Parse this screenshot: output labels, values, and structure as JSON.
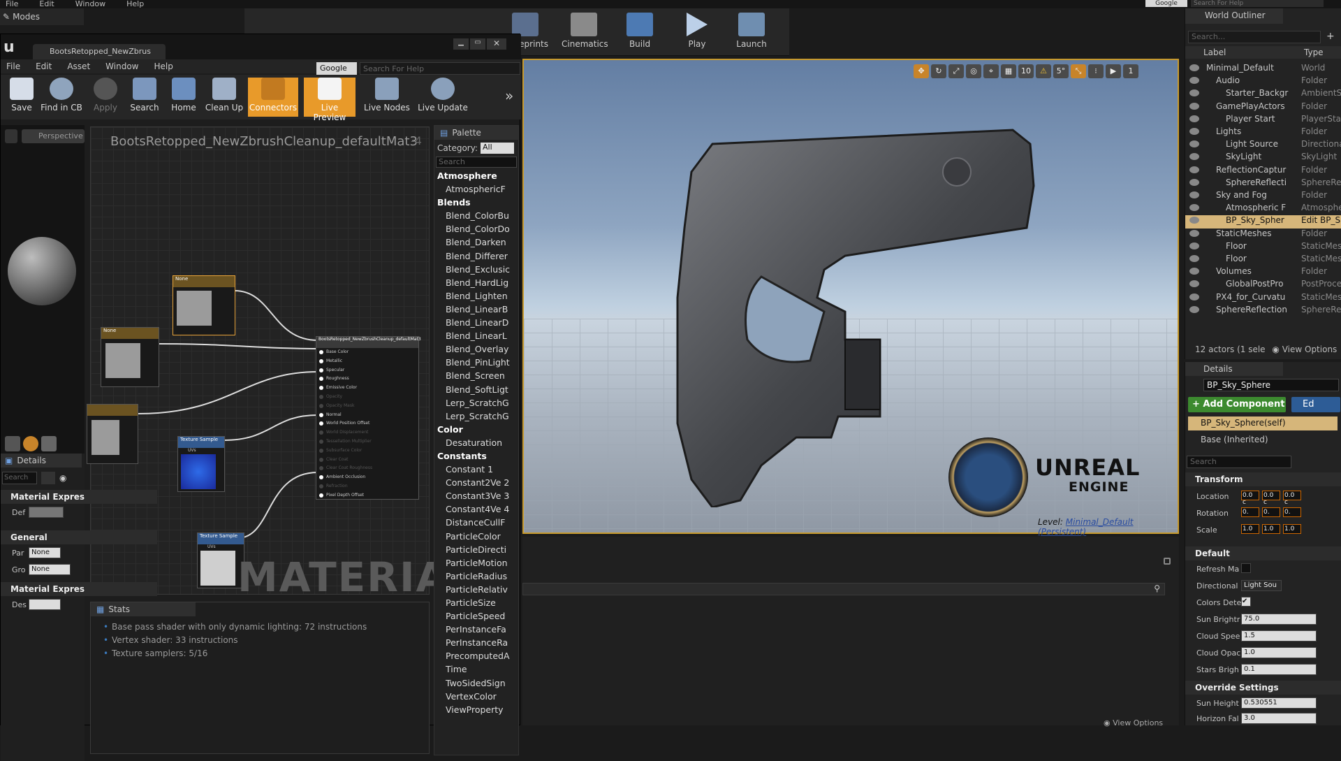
{
  "top_menu": [
    "File",
    "Edit",
    "Window",
    "Help"
  ],
  "top_google": "Google",
  "top_help_placeholder": "Search For Help",
  "modes_label": "Modes",
  "main_toolbar": [
    "Blueprints",
    "Cinematics",
    "Build",
    "Play",
    "Launch"
  ],
  "material_editor": {
    "tab_title": "BootsRetopped_NewZbrus",
    "menu": [
      "File",
      "Edit",
      "Asset",
      "Window",
      "Help"
    ],
    "google": "Google",
    "help_placeholder": "Search For Help",
    "toolbar": [
      "Save",
      "Find in CB",
      "Apply",
      "Search",
      "Home",
      "Clean Up",
      "Connectors",
      "Live Preview",
      "Live Nodes",
      "Live Update"
    ],
    "viewport_mode": "Perspective",
    "graph_title": "BootsRetopped_NewZbrushCleanup_defaultMat3",
    "graph_zoom": "-4",
    "watermark": "MATERIAL",
    "main_node_title": "BootsRetopped_NewZbrushCleanup_defaultMat3",
    "main_node_pins": [
      "Base Color",
      "Metallic",
      "Specular",
      "Roughness",
      "Emissive Color",
      "Opacity",
      "Opacity Mask",
      "Normal",
      "World Position Offset",
      "World Displacement",
      "Tessellation Multiplier",
      "Subsurface Color",
      "Clear Coat",
      "Clear Coat Roughness",
      "Ambient Occlusion",
      "Refraction",
      "Pixel Depth Offset"
    ],
    "texture_node_title": "Texture Sample",
    "texture_node_pin": "UVs",
    "param_node_title": "None"
  },
  "left_details": {
    "tab": "Details",
    "search_placeholder": "Search",
    "sec_material": "Material Expres",
    "def_label": "Def",
    "sec_general": "General",
    "par_label": "Par",
    "par_value": "None",
    "gro_label": "Gro",
    "gro_value": "None",
    "sec_material2": "Material Expres",
    "des_label": "Des"
  },
  "palette": {
    "tab": "Palette",
    "category_label": "Category:",
    "category_value": "All",
    "search_placeholder": "Search",
    "items": [
      {
        "t": "Atmosphere",
        "cat": true
      },
      {
        "t": "AtmosphericF",
        "cat": false
      },
      {
        "t": "Blends",
        "cat": true
      },
      {
        "t": "Blend_ColorBu",
        "cat": false
      },
      {
        "t": "Blend_ColorDo",
        "cat": false
      },
      {
        "t": "Blend_Darken",
        "cat": false
      },
      {
        "t": "Blend_Differer",
        "cat": false
      },
      {
        "t": "Blend_Exclusic",
        "cat": false
      },
      {
        "t": "Blend_HardLig",
        "cat": false
      },
      {
        "t": "Blend_Lighten",
        "cat": false
      },
      {
        "t": "Blend_LinearB",
        "cat": false
      },
      {
        "t": "Blend_LinearD",
        "cat": false
      },
      {
        "t": "Blend_LinearL",
        "cat": false
      },
      {
        "t": "Blend_Overlay",
        "cat": false
      },
      {
        "t": "Blend_PinLight",
        "cat": false
      },
      {
        "t": "Blend_Screen",
        "cat": false
      },
      {
        "t": "Blend_SoftLigt",
        "cat": false
      },
      {
        "t": "Lerp_ScratchG",
        "cat": false
      },
      {
        "t": "Lerp_ScratchG",
        "cat": false
      },
      {
        "t": "Color",
        "cat": true
      },
      {
        "t": "Desaturation",
        "cat": false
      },
      {
        "t": "Constants",
        "cat": true
      },
      {
        "t": "Constant       1",
        "cat": false
      },
      {
        "t": "Constant2Ve 2",
        "cat": false
      },
      {
        "t": "Constant3Ve 3",
        "cat": false
      },
      {
        "t": "Constant4Ve 4",
        "cat": false
      },
      {
        "t": "DistanceCullF",
        "cat": false
      },
      {
        "t": "ParticleColor",
        "cat": false
      },
      {
        "t": "ParticleDirecti",
        "cat": false
      },
      {
        "t": "ParticleMotion",
        "cat": false
      },
      {
        "t": "ParticleRadius",
        "cat": false
      },
      {
        "t": "ParticleRelativ",
        "cat": false
      },
      {
        "t": "ParticleSize",
        "cat": false
      },
      {
        "t": "ParticleSpeed",
        "cat": false
      },
      {
        "t": "PerInstanceFa",
        "cat": false
      },
      {
        "t": "PerInstanceRa",
        "cat": false
      },
      {
        "t": "PrecomputedA",
        "cat": false
      },
      {
        "t": "Time",
        "cat": false
      },
      {
        "t": "TwoSidedSign",
        "cat": false
      },
      {
        "t": "VertexColor",
        "cat": false
      },
      {
        "t": "ViewProperty",
        "cat": false
      }
    ]
  },
  "stats": {
    "tab": "Stats",
    "lines": [
      "Base pass shader with only dynamic lighting: 72 instructions",
      "Vertex shader: 33 instructions",
      "Texture samplers: 5/16"
    ]
  },
  "viewport": {
    "toolbar_values": [
      "10",
      "5°",
      "1"
    ],
    "engine_logo_line1": "UNREAL",
    "engine_logo_line2": "ENGINE",
    "level_label": "Level:",
    "level_value": "Minimal_Default (Persistent)"
  },
  "world_outliner": {
    "tab": "World Outliner",
    "search_placeholder": "Search...",
    "col_label": "Label",
    "col_type": "Type",
    "rows": [
      {
        "label": "Minimal_Default",
        "type": "World",
        "indent": 0,
        "sel": false
      },
      {
        "label": "Audio",
        "type": "Folder",
        "indent": 1,
        "sel": false
      },
      {
        "label": "Starter_Backgr",
        "type": "AmbientSo",
        "indent": 2,
        "sel": false
      },
      {
        "label": "GamePlayActors",
        "type": "Folder",
        "indent": 1,
        "sel": false
      },
      {
        "label": "Player Start",
        "type": "PlayerStar",
        "indent": 2,
        "sel": false
      },
      {
        "label": "Lights",
        "type": "Folder",
        "indent": 1,
        "sel": false
      },
      {
        "label": "Light Source",
        "type": "Directiona",
        "indent": 2,
        "sel": false
      },
      {
        "label": "SkyLight",
        "type": "SkyLight",
        "indent": 2,
        "sel": false
      },
      {
        "label": "ReflectionCaptur",
        "type": "Folder",
        "indent": 1,
        "sel": false
      },
      {
        "label": "SphereReflecti",
        "type": "SphereRef",
        "indent": 2,
        "sel": false
      },
      {
        "label": "Sky and Fog",
        "type": "Folder",
        "indent": 1,
        "sel": false
      },
      {
        "label": "Atmospheric F",
        "type": "Atmospher",
        "indent": 2,
        "sel": false
      },
      {
        "label": "BP_Sky_Spher",
        "type": "Edit BP_S",
        "indent": 2,
        "sel": true
      },
      {
        "label": "StaticMeshes",
        "type": "Folder",
        "indent": 1,
        "sel": false
      },
      {
        "label": "Floor",
        "type": "StaticMesh",
        "indent": 2,
        "sel": false
      },
      {
        "label": "Floor",
        "type": "StaticMesh",
        "indent": 2,
        "sel": false
      },
      {
        "label": "Volumes",
        "type": "Folder",
        "indent": 1,
        "sel": false
      },
      {
        "label": "GlobalPostPro",
        "type": "PostProce",
        "indent": 2,
        "sel": false
      },
      {
        "label": "PX4_for_Curvatu",
        "type": "StaticMesh",
        "indent": 1,
        "sel": false
      },
      {
        "label": "SphereReflection",
        "type": "SphereRef",
        "indent": 1,
        "sel": false
      }
    ],
    "status": "12 actors (1 sele",
    "view_options": "View Options"
  },
  "details": {
    "tab": "Details",
    "name": "BP_Sky_Sphere",
    "add_component": "+ Add Component",
    "edit_bp": "Ed",
    "self_row": "BP_Sky_Sphere(self)",
    "base_row": "Base (Inherited)",
    "search_placeholder": "Search",
    "sec_transform": "Transform",
    "location": "Location",
    "rotation": "Rotation",
    "scale": "Scale",
    "loc_vals": [
      "0.0 c",
      "0.0 c",
      "0.0 c"
    ],
    "rot_vals": [
      "0.",
      "0.",
      "0."
    ],
    "scale_vals": [
      "1.0",
      "1.0",
      "1.0"
    ],
    "sec_default": "Default",
    "refresh": "Refresh Ma",
    "directional": "Directional",
    "directional_val": "Light Sou",
    "colors_dete": "Colors Dete",
    "sun_bright": "Sun Brightr",
    "sun_bright_val": "75.0",
    "cloud_speed": "Cloud Spee",
    "cloud_speed_val": "1.5",
    "cloud_opac": "Cloud Opac",
    "cloud_opac_val": "1.0",
    "stars_bright": "Stars Brigh",
    "stars_bright_val": "0.1",
    "sec_override": "Override Settings",
    "sun_height": "Sun Height",
    "sun_height_val": "0.530551",
    "horizon_fal": "Horizon Fal",
    "horizon_fal_val": "3.0"
  },
  "bottom_view_options": "View Options"
}
